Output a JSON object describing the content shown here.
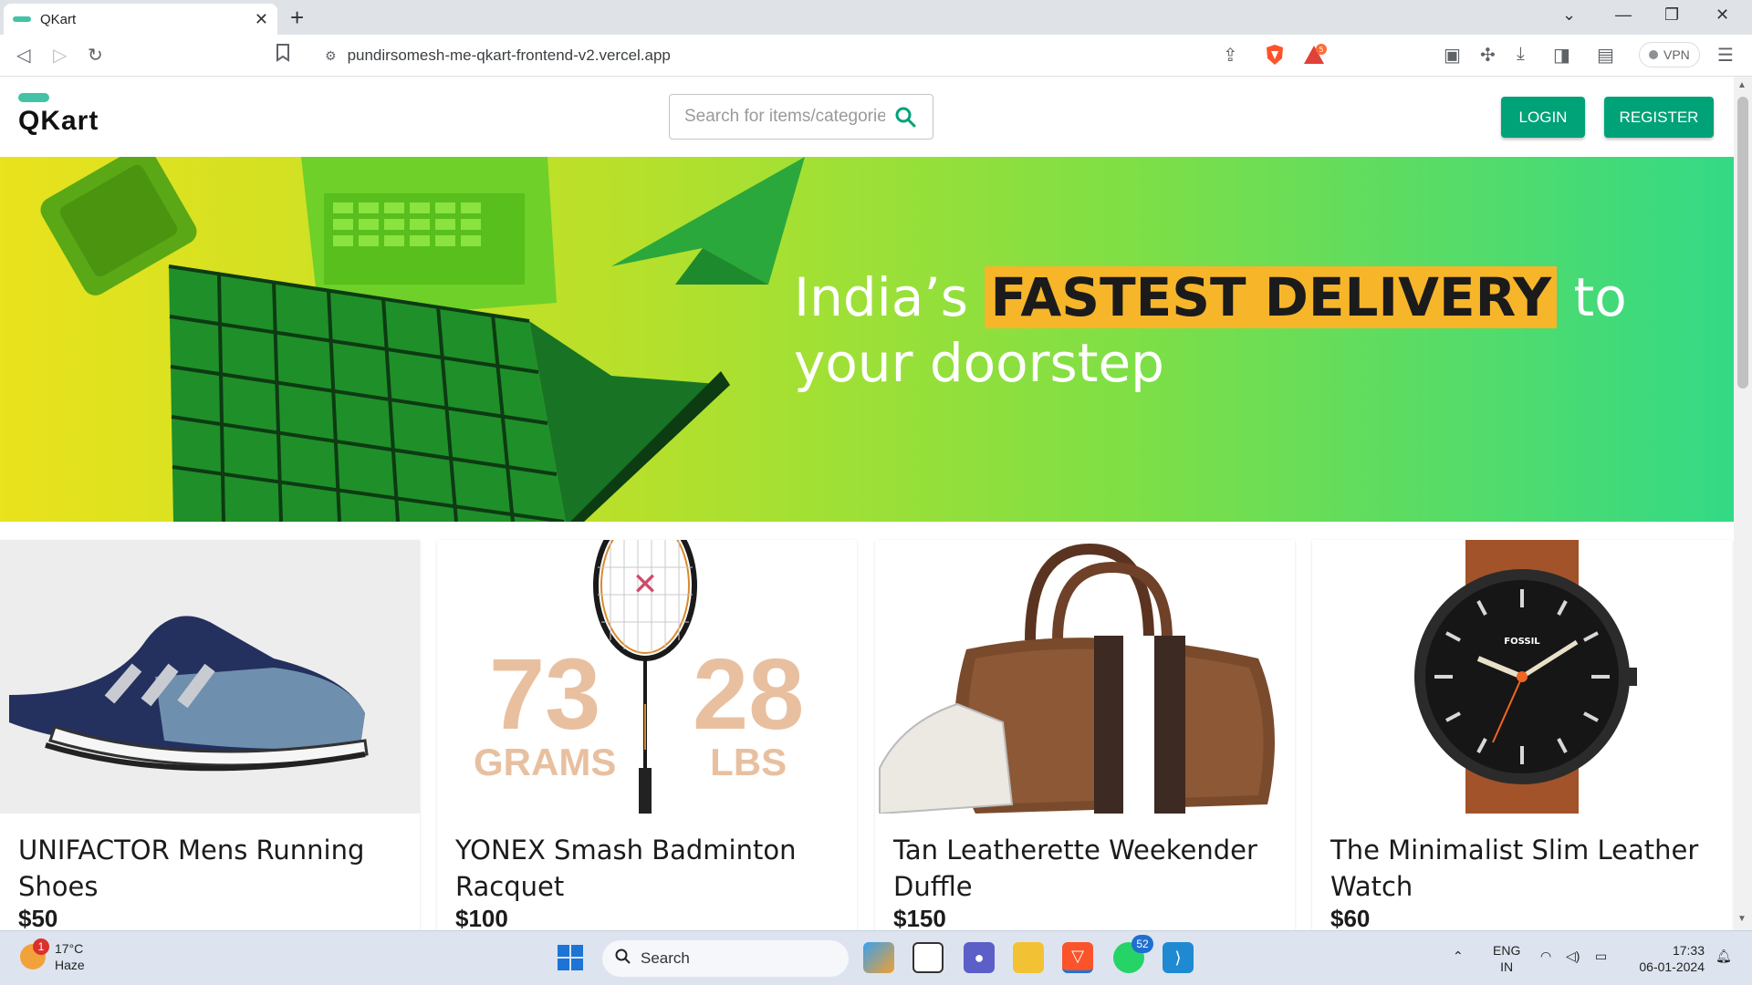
{
  "browser": {
    "tab_title": "QKart",
    "url": "pundirsomesh-me-qkart-frontend-v2.vercel.app",
    "vpn_label": "VPN",
    "shield_badge_count": "5"
  },
  "header": {
    "logo_text": "QKart",
    "search_placeholder": "Search for items/categories",
    "login_label": "LOGIN",
    "register_label": "REGISTER"
  },
  "hero": {
    "text_before": "India’s ",
    "highlight": "FASTEST DELIVERY",
    "text_after": " to",
    "line2": "your doorstep"
  },
  "products": [
    {
      "name": "UNIFACTOR Mens Running Shoes",
      "price": "$50"
    },
    {
      "name": "YONEX Smash Badminton Racquet",
      "price": "$100"
    },
    {
      "name": "Tan Leatherette Weekender Duffle",
      "price": "$150"
    },
    {
      "name": "The Minimalist Slim Leather Watch",
      "price": "$60"
    }
  ],
  "racquet_image": {
    "left_number": "73",
    "left_unit": "GRAMS",
    "right_number": "28",
    "right_unit": "LBS"
  },
  "watch_image": {
    "brand": "FOSSIL"
  },
  "taskbar": {
    "weather_temp": "17°C",
    "weather_desc": "Haze",
    "weather_badge": "1",
    "search_label": "Search",
    "whatsapp_badge": "52",
    "lang_line1": "ENG",
    "lang_line2": "IN",
    "time": "17:33",
    "date": "06-01-2024"
  },
  "colors": {
    "brand_green": "#00a278",
    "logo_accent": "#44c2a6",
    "hero_highlight": "#f7b52a"
  }
}
